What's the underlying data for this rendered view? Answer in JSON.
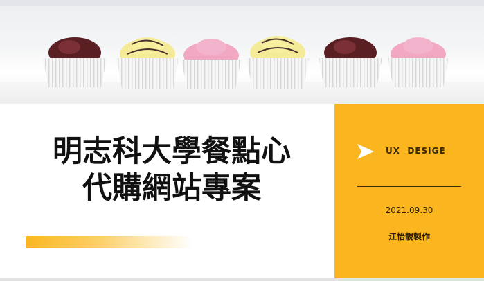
{
  "slide": {
    "title_line1": "明志科大學餐點心",
    "title_line2": "代購網站專案",
    "panel": {
      "label": "UX  DESIGE",
      "date": "2021.09.30",
      "author": "江怡靚製作"
    },
    "colors": {
      "accent": "#fbb61f",
      "text": "#111111"
    },
    "banner_image": "row of six pastel cupcakes in white paper liners"
  }
}
